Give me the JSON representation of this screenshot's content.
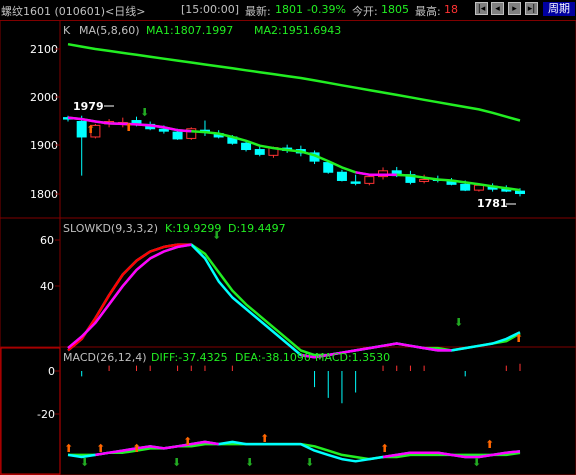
{
  "header": {
    "title": "螺纹1601 (010601)<日线>",
    "time": "[15:00:00]",
    "latest_label": "最新:",
    "latest": "1801",
    "change": "-0.39%",
    "open_label": "今开:",
    "open": "1805",
    "high_label": "最高:",
    "high": "18",
    "period_label": "周期",
    "nav_icons": [
      "first-icon",
      "prev-icon",
      "next-icon",
      "last-icon"
    ]
  },
  "colors": {
    "up": "#ff3333",
    "down": "#00ffff",
    "ma_fast": "#ffffff",
    "ma_slow": "#22ee22",
    "grid": "#800000",
    "axis_text": "#ffffff"
  },
  "panels": {
    "price": {
      "label_k": "K",
      "label_ma": "MA(5,8,60)",
      "ma1": "MA1:1807.1997",
      "ma2": "MA2:1951.6943",
      "ticks": [
        "2100",
        "2000",
        "1900",
        "1800"
      ],
      "annot_high": "1979",
      "annot_low": "1781"
    },
    "kd": {
      "label": "SLOWKD(9,3,3,2)",
      "k": "K:19.9299",
      "d": "D:19.4497",
      "ticks": [
        "60",
        "40"
      ]
    },
    "macd": {
      "label": "MACD(26,12,4)",
      "diff": "DIFF:-37.4325",
      "dea": "DEA:-38.1090",
      "macd": "MACD:1.3530",
      "ticks": [
        "0",
        "-20"
      ]
    }
  },
  "chart_data": [
    {
      "type": "candlestick",
      "title": "K MA(5,8,60)",
      "ylim": [
        1770,
        2130
      ],
      "candles": [
        {
          "o": 1958,
          "h": 1962,
          "l": 1950,
          "c": 1955
        },
        {
          "o": 1950,
          "h": 1962,
          "l": 1838,
          "c": 1918
        },
        {
          "o": 1918,
          "h": 1945,
          "l": 1915,
          "c": 1942
        },
        {
          "o": 1945,
          "h": 1955,
          "l": 1938,
          "c": 1950
        },
        {
          "o": 1946,
          "h": 1958,
          "l": 1938,
          "c": 1948
        },
        {
          "o": 1952,
          "h": 1960,
          "l": 1940,
          "c": 1944
        },
        {
          "o": 1944,
          "h": 1950,
          "l": 1932,
          "c": 1935
        },
        {
          "o": 1934,
          "h": 1942,
          "l": 1925,
          "c": 1930
        },
        {
          "o": 1928,
          "h": 1935,
          "l": 1912,
          "c": 1914
        },
        {
          "o": 1915,
          "h": 1938,
          "l": 1912,
          "c": 1935
        },
        {
          "o": 1932,
          "h": 1952,
          "l": 1920,
          "c": 1928
        },
        {
          "o": 1925,
          "h": 1932,
          "l": 1915,
          "c": 1918
        },
        {
          "o": 1918,
          "h": 1922,
          "l": 1902,
          "c": 1905
        },
        {
          "o": 1905,
          "h": 1910,
          "l": 1888,
          "c": 1892
        },
        {
          "o": 1892,
          "h": 1902,
          "l": 1878,
          "c": 1882
        },
        {
          "o": 1880,
          "h": 1898,
          "l": 1875,
          "c": 1896
        },
        {
          "o": 1895,
          "h": 1902,
          "l": 1885,
          "c": 1890
        },
        {
          "o": 1892,
          "h": 1900,
          "l": 1878,
          "c": 1885
        },
        {
          "o": 1885,
          "h": 1890,
          "l": 1862,
          "c": 1868
        },
        {
          "o": 1865,
          "h": 1870,
          "l": 1842,
          "c": 1845
        },
        {
          "o": 1845,
          "h": 1850,
          "l": 1826,
          "c": 1828
        },
        {
          "o": 1825,
          "h": 1840,
          "l": 1818,
          "c": 1822
        },
        {
          "o": 1822,
          "h": 1840,
          "l": 1818,
          "c": 1836
        },
        {
          "o": 1836,
          "h": 1855,
          "l": 1830,
          "c": 1848
        },
        {
          "o": 1848,
          "h": 1856,
          "l": 1835,
          "c": 1838
        },
        {
          "o": 1840,
          "h": 1848,
          "l": 1820,
          "c": 1824
        },
        {
          "o": 1826,
          "h": 1840,
          "l": 1822,
          "c": 1830
        },
        {
          "o": 1830,
          "h": 1838,
          "l": 1824,
          "c": 1828
        },
        {
          "o": 1828,
          "h": 1833,
          "l": 1818,
          "c": 1820
        },
        {
          "o": 1820,
          "h": 1828,
          "l": 1806,
          "c": 1808
        },
        {
          "o": 1808,
          "h": 1822,
          "l": 1805,
          "c": 1818
        },
        {
          "o": 1816,
          "h": 1822,
          "l": 1805,
          "c": 1810
        },
        {
          "o": 1812,
          "h": 1818,
          "l": 1804,
          "c": 1806
        },
        {
          "o": 1806,
          "h": 1812,
          "l": 1795,
          "c": 1801
        }
      ],
      "ma_fast": [
        1958,
        1955,
        1950,
        1946,
        1945,
        1944,
        1942,
        1938,
        1932,
        1930,
        1928,
        1925,
        1918,
        1910,
        1900,
        1895,
        1891,
        1888,
        1880,
        1868,
        1855,
        1845,
        1840,
        1840,
        1840,
        1838,
        1834,
        1830,
        1828,
        1824,
        1820,
        1816,
        1812,
        1808
      ],
      "ma_slow": [
        2110,
        2105,
        2100,
        2096,
        2092,
        2088,
        2084,
        2080,
        2076,
        2072,
        2068,
        2064,
        2060,
        2056,
        2052,
        2048,
        2044,
        2040,
        2035,
        2030,
        2025,
        2020,
        2015,
        2010,
        2005,
        2000,
        1995,
        1990,
        1985,
        1980,
        1975,
        1968,
        1960,
        1952
      ],
      "high_mark": 1979,
      "low_mark": 1781
    },
    {
      "type": "line",
      "title": "SLOWKD(9,3,3,2)",
      "ylim": [
        10,
        66
      ],
      "series": [
        {
          "name": "K",
          "values": [
            12,
            17,
            26,
            36,
            45,
            51,
            55,
            57,
            58,
            58,
            52,
            42,
            35,
            30,
            25,
            20,
            15,
            10,
            9,
            10,
            11,
            12,
            13,
            14,
            15,
            14,
            13,
            12,
            12,
            13,
            14,
            15,
            17,
            19.9
          ]
        },
        {
          "name": "D",
          "values": [
            13,
            18,
            24,
            32,
            40,
            47,
            52,
            55,
            57,
            58,
            54,
            46,
            38,
            32,
            27,
            22,
            17,
            12,
            10,
            10,
            11,
            12,
            13,
            14,
            15,
            14,
            13,
            13,
            12,
            13,
            14,
            15,
            16,
            19.4
          ]
        }
      ]
    },
    {
      "type": "line",
      "title": "MACD(26,12,4)",
      "ylim": [
        -44,
        4
      ],
      "series": [
        {
          "name": "DIFF",
          "values": [
            -39,
            -40,
            -39,
            -38,
            -37,
            -36,
            -35,
            -36,
            -35,
            -34,
            -33,
            -34,
            -33,
            -34,
            -34,
            -34,
            -34,
            -34,
            -37,
            -39,
            -41,
            -42,
            -41,
            -40,
            -39,
            -38,
            -38,
            -38,
            -39,
            -40,
            -40,
            -39,
            -38,
            -37.4
          ]
        },
        {
          "name": "DEA",
          "values": [
            -39,
            -39,
            -39,
            -38,
            -38,
            -37,
            -36,
            -36,
            -35,
            -35,
            -34,
            -34,
            -34,
            -34,
            -34,
            -34,
            -34,
            -34,
            -35,
            -37,
            -39,
            -40,
            -41,
            -40,
            -40,
            -39,
            -39,
            -39,
            -39,
            -39,
            -39,
            -39,
            -39,
            -38.1
          ]
        }
      ],
      "macd_bars": [
        0,
        -1,
        0,
        1,
        0,
        1,
        1,
        0,
        1,
        1,
        1,
        0,
        1,
        0,
        0,
        0,
        0,
        0,
        -3,
        -5,
        -6,
        -4,
        0,
        1,
        1,
        1,
        1,
        0,
        0,
        -1,
        0,
        0,
        1,
        1.35
      ]
    }
  ]
}
